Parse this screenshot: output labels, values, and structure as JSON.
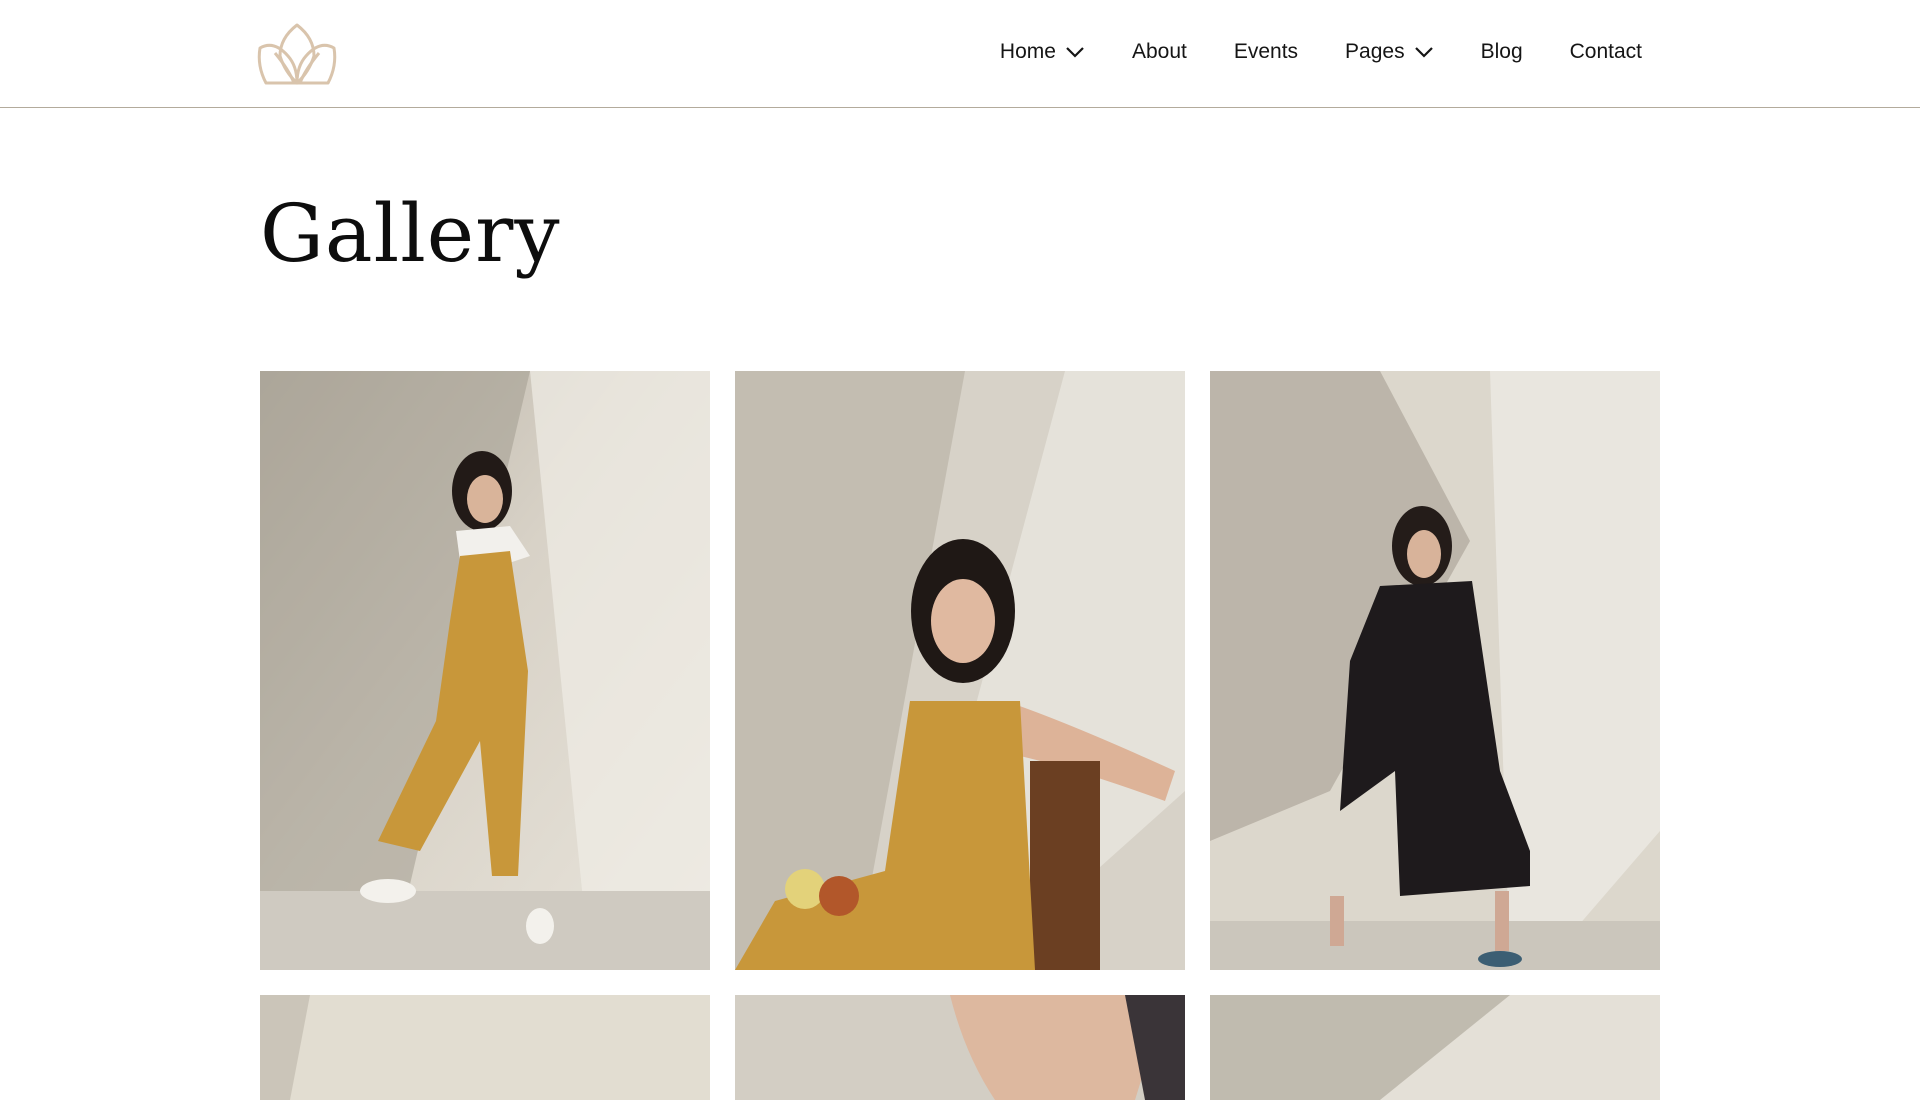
{
  "header": {
    "logo_icon": "lotus-logo-icon",
    "nav": [
      {
        "label": "Home",
        "has_dropdown": true
      },
      {
        "label": "About",
        "has_dropdown": false
      },
      {
        "label": "Events",
        "has_dropdown": false
      },
      {
        "label": "Pages",
        "has_dropdown": true
      },
      {
        "label": "Blog",
        "has_dropdown": false
      },
      {
        "label": "Contact",
        "has_dropdown": false
      }
    ]
  },
  "page": {
    "title": "Gallery"
  },
  "gallery": {
    "photos": [
      {
        "name": "gallery-photo-1"
      },
      {
        "name": "gallery-photo-2"
      },
      {
        "name": "gallery-photo-3"
      },
      {
        "name": "gallery-photo-4"
      },
      {
        "name": "gallery-photo-5"
      },
      {
        "name": "gallery-photo-6"
      }
    ]
  },
  "colors": {
    "logo": "#d9c4ac",
    "header_border": "#b3ab9c",
    "backdrop": "#e6e1d6",
    "mustard": "#c8973a",
    "dark_outfit": "#1e1a1c"
  }
}
